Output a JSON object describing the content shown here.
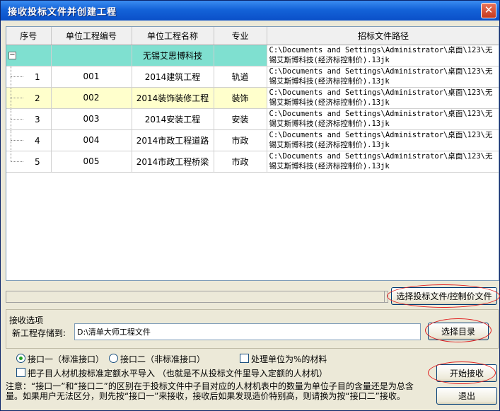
{
  "window": {
    "title": "接收投标文件并创建工程",
    "close_label": "✕"
  },
  "table": {
    "headers": [
      "序号",
      "单位工程编号",
      "单位工程名称",
      "专业",
      "招标文件路径"
    ],
    "group": {
      "expander": "−",
      "name": "无锡艾思博科技",
      "path": "C:\\Documents and Settings\\Administrator\\桌面\\123\\无锡艾斯博科技(经济标控制价).13jk"
    },
    "rows": [
      {
        "seq": "1",
        "code": "001",
        "name": "2014建筑工程",
        "major": "轨道",
        "path": "C:\\Documents and Settings\\Administrator\\桌面\\123\\无锡艾斯博科技(经济标控制价).13jk"
      },
      {
        "seq": "2",
        "code": "002",
        "name": "2014装饰装修工程",
        "major": "装饰",
        "path": "C:\\Documents and Settings\\Administrator\\桌面\\123\\无锡艾斯博科技(经济标控制价).13jk"
      },
      {
        "seq": "3",
        "code": "003",
        "name": "2014安装工程",
        "major": "安装",
        "path": "C:\\Documents and Settings\\Administrator\\桌面\\123\\无锡艾斯博科技(经济标控制价).13jk"
      },
      {
        "seq": "4",
        "code": "004",
        "name": "2014市政工程道路",
        "major": "市政",
        "path": "C:\\Documents and Settings\\Administrator\\桌面\\123\\无锡艾斯博科技(经济标控制价).13jk"
      },
      {
        "seq": "5",
        "code": "005",
        "name": "2014市政工程桥梁",
        "major": "市政",
        "path": "C:\\Documents and Settings\\Administrator\\桌面\\123\\无锡艾斯博科技(经济标控制价).13jk"
      }
    ]
  },
  "buttons": {
    "select_file": "选择投标文件/控制价文件",
    "select_dir": "选择目录",
    "start": "开始接收",
    "exit": "退出"
  },
  "options": {
    "legend": "接收选项",
    "store_label": "新工程存储到:",
    "store_value": "D:\\清单大师工程文件",
    "radio1": "接口一（标准接口）",
    "radio2": "接口二（非标准接口）",
    "check_unit": "处理单位为%的材料",
    "check_quota": "把子目人材机按标准定额水平导入 （也就是不从投标文件里导入定额的人材机）"
  },
  "note": "注意：“接口一”和“接口二”的区别在于投标文件中子目对应的人材机表中的数量为单位子目的含量还是为总含量。如果用户无法区分，则先按“接口一”来接收，接收后如果发现造价特别高，则请换为按“接口二”接收。",
  "colors": {
    "title_bar": "#1463d8",
    "group_row": "#7fe0d0",
    "highlight_row": "#ffffcc",
    "annotation_ring": "#e02020"
  }
}
